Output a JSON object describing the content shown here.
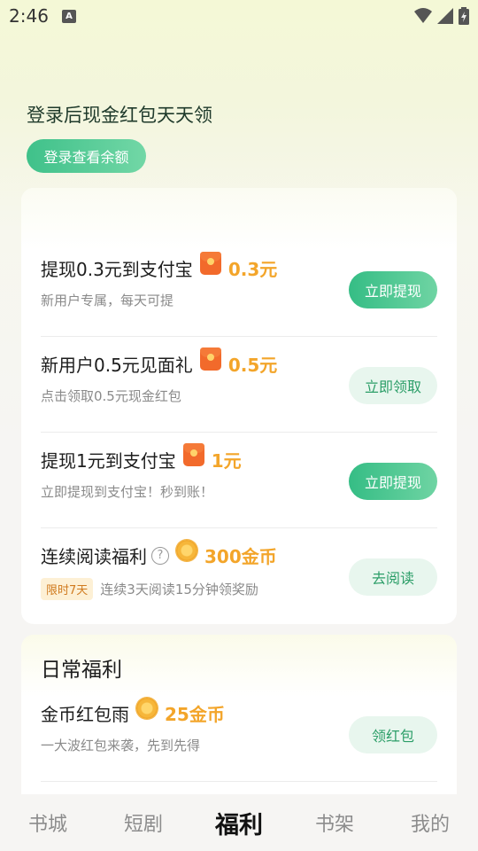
{
  "status_bar": {
    "time": "2:46",
    "notification_glyph": "A"
  },
  "hero": {
    "title": "登录后现金红包天天领",
    "login_button": "登录查看余额"
  },
  "tasks": [
    {
      "title": "提现0.3元到支付宝",
      "icon": "red-packet-icon",
      "reward": "0.3元",
      "subtitle": "新用户专属，每天可提",
      "button": "立即提现",
      "button_style": "solid"
    },
    {
      "title": "新用户0.5元见面礼",
      "icon": "red-packet-icon",
      "reward": "0.5元",
      "subtitle": "点击领取0.5元现金红包",
      "button": "立即领取",
      "button_style": "soft"
    },
    {
      "title": "提现1元到支付宝",
      "icon": "red-packet-icon",
      "reward": "1元",
      "subtitle": "立即提现到支付宝！秒到账！",
      "button": "立即提现",
      "button_style": "solid"
    },
    {
      "title": "连续阅读福利",
      "icon": "coin-icon",
      "help": "?",
      "reward": "300金币",
      "badge": "限时7天",
      "subtitle": "连续3天阅读15分钟领奖励",
      "button": "去阅读",
      "button_style": "soft"
    }
  ],
  "daily": {
    "title": "日常福利",
    "items": [
      {
        "title": "金币红包雨",
        "icon": "coin-icon",
        "reward": "25金币",
        "subtitle": "一大波红包来袭，先到先得",
        "button": "领红包"
      }
    ]
  },
  "tabbar": {
    "tabs": [
      "书城",
      "短剧",
      "福利",
      "书架",
      "我的"
    ],
    "active": "福利"
  },
  "colors": {
    "accent_green": "#35bd85",
    "reward_orange": "#f3a52a",
    "red_packet": "#f26a2b"
  }
}
